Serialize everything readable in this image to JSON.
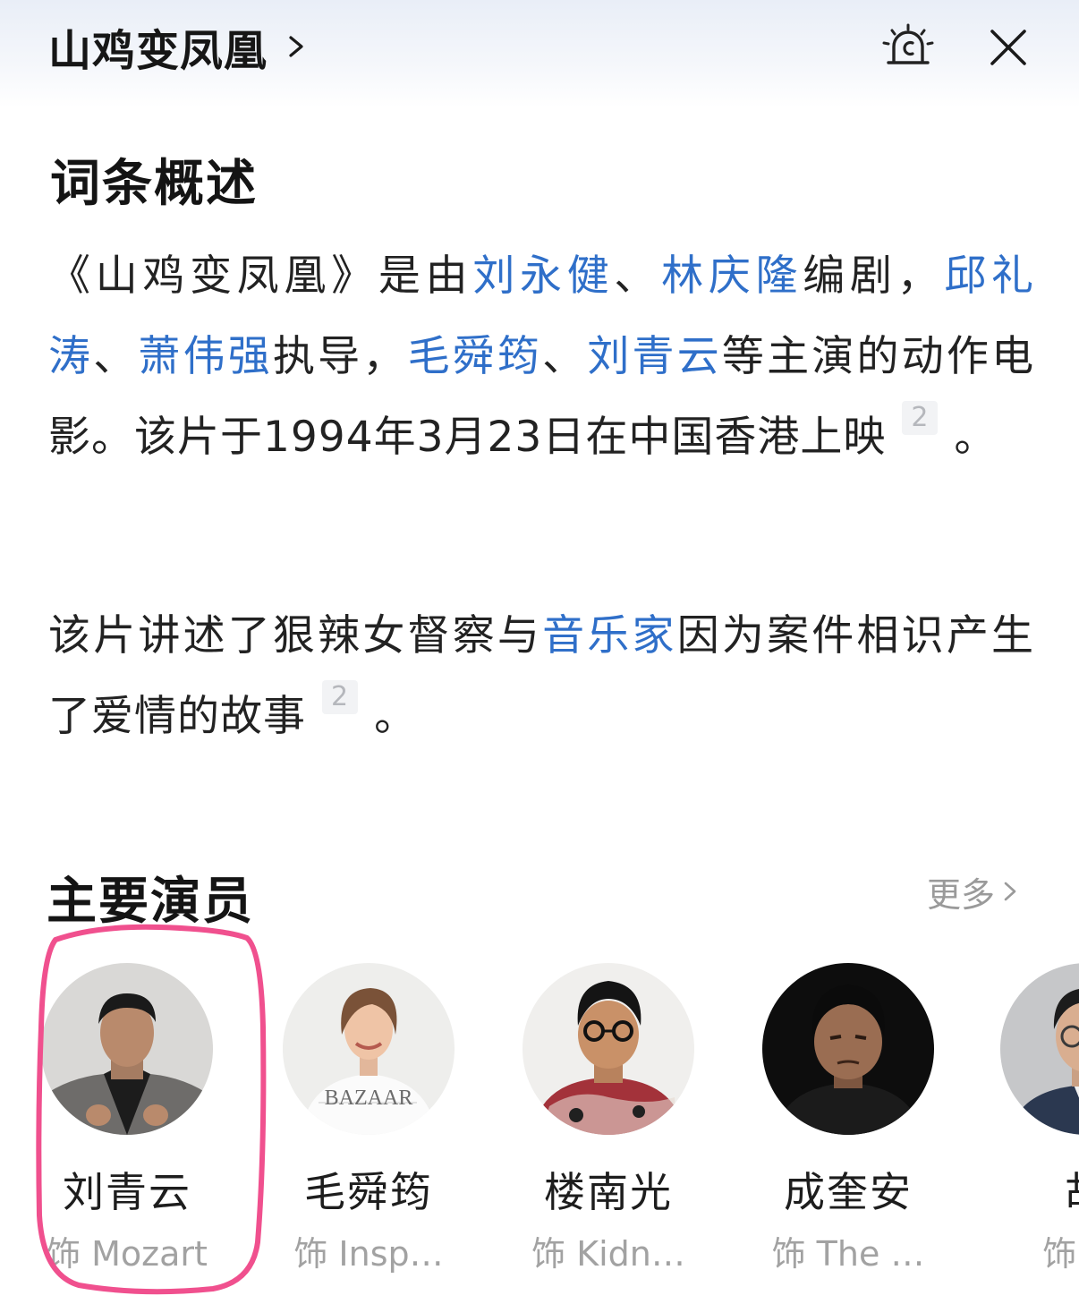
{
  "header": {
    "title": "山鸡变凤凰"
  },
  "overview": {
    "heading": "词条概述",
    "p1": {
      "t1": "《山鸡变凤凰》是由",
      "l1": "刘永健",
      "t2": "、",
      "l2": "林庆隆",
      "t3": "编剧，",
      "l3": "邱礼涛",
      "t4": "、",
      "l4": "萧伟强",
      "t5": "执导，",
      "l5": "毛舜筠",
      "t6": "、",
      "l6": "刘青云",
      "t7": "等主演的动作电影。该片于1994年3月23日在中国香港上映",
      "ref": "2",
      "t8": "。"
    },
    "p2": {
      "t1": "该片讲述了狠辣女督察与",
      "l1": "音乐家",
      "t2": "因为案件相识产生了爱情的故事",
      "ref": "2",
      "t3": "。"
    }
  },
  "cast": {
    "heading": "主要演员",
    "more": "更多",
    "actors": [
      {
        "name": "刘青云",
        "role": "饰 Mozart"
      },
      {
        "name": "毛舜筠",
        "role": "饰 Insp…"
      },
      {
        "name": "楼南光",
        "role": "饰 Kidn…"
      },
      {
        "name": "成奎安",
        "role": "饰 The …"
      },
      {
        "name": "胡",
        "role": "饰 Th"
      }
    ]
  },
  "colors": {
    "link": "#2f6fc9",
    "highlight": "#f0508e",
    "secondary_text": "#a2a2a2"
  }
}
